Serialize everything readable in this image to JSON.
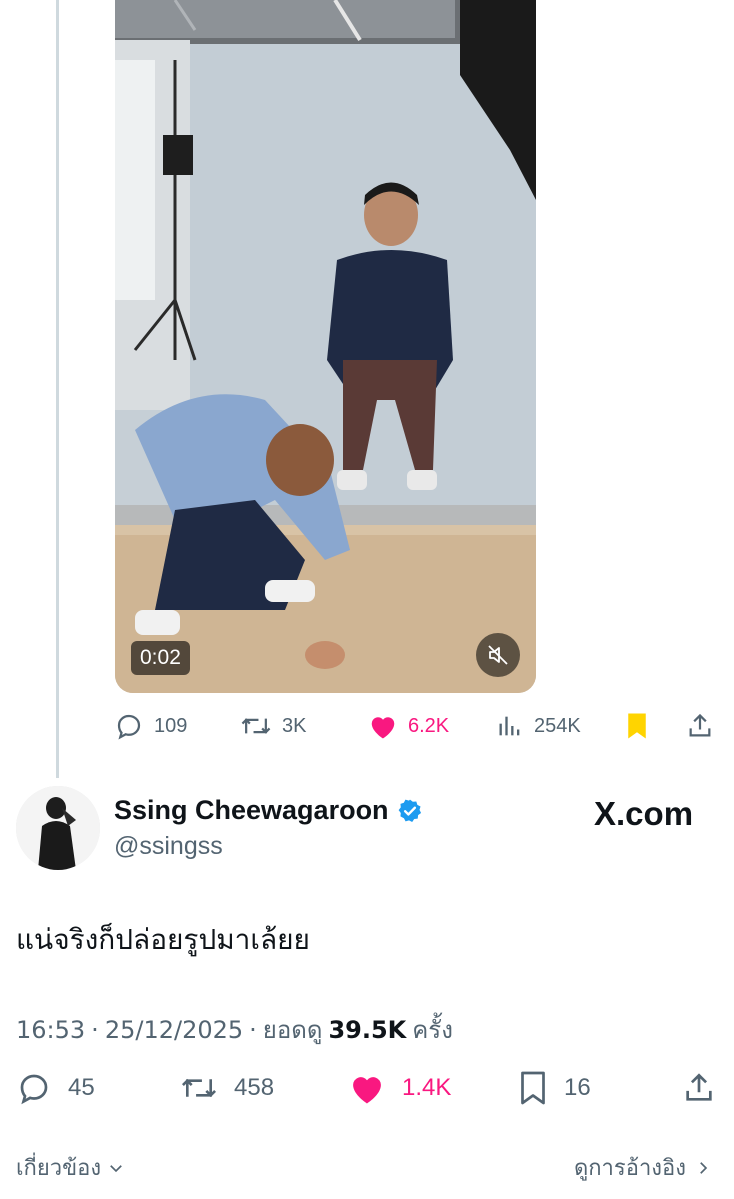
{
  "quoted_post": {
    "video": {
      "duration": "0:02",
      "muted": true
    },
    "actions": {
      "replies": "109",
      "reposts": "3K",
      "likes": "6.2K",
      "views": "254K"
    }
  },
  "post": {
    "author_name": "Ssing Cheewagaroon",
    "handle": "@ssingss",
    "verified": true,
    "watermark": "X.com",
    "text": "แน่จริงก็ปล่อยรูปมาเล้ยย",
    "time": "16:53",
    "date": "25/12/2025",
    "views_label": "ยอดดู",
    "views_count": "39.5K",
    "views_suffix": "ครั้ง",
    "actions": {
      "replies": "45",
      "reposts": "458",
      "likes": "1.4K",
      "bookmarks": "16"
    }
  },
  "footer": {
    "related_label": "เกี่ยวข้อง",
    "quotes_label": "ดูการอ้างอิง"
  },
  "colors": {
    "like": "#f91880",
    "bookmark_active": "#ffd400",
    "verified": "#1d9bf0",
    "muted_text": "#536471"
  },
  "icons": [
    "reply-icon",
    "repost-icon",
    "heart-icon",
    "views-icon",
    "bookmark-icon",
    "share-icon",
    "verified-badge-icon",
    "mute-icon",
    "chevron-down-icon",
    "chevron-right-icon"
  ]
}
